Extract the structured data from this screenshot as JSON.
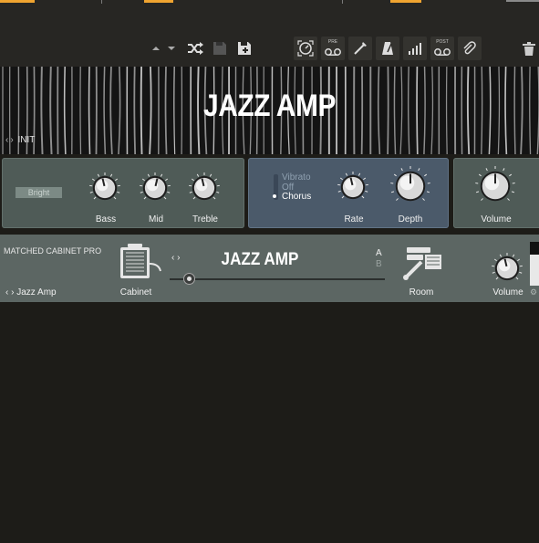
{
  "colors": {
    "accent": "#f0a430",
    "background": "#1d1c18",
    "toolbar": "#272623",
    "amp_panel": "#4f5b57",
    "mod_panel": "#4b5a6a",
    "cab_panel": "#5c6663"
  },
  "toolbar": {
    "icons": [
      "chevron-up-icon",
      "chevron-down-icon",
      "shuffle-icon",
      "save-icon",
      "save-as-icon",
      "tuner-icon",
      "pre-tape-icon",
      "pick-icon",
      "metronome-icon",
      "level-meter-icon",
      "post-tape-icon",
      "paperclip-icon",
      "trash-icon"
    ],
    "pre_label": "PRE",
    "post_label": "POST"
  },
  "amp": {
    "title": "JAZZ AMP",
    "preset_name": "INIT"
  },
  "eq_panel": {
    "bright_label": "Bright",
    "bright_on": false,
    "knobs": [
      {
        "label": "Bass",
        "value": 0.45
      },
      {
        "label": "Mid",
        "value": 0.55
      },
      {
        "label": "Treble",
        "value": 0.45
      }
    ]
  },
  "mod_panel": {
    "options": [
      "Vibrato",
      "Off",
      "Chorus"
    ],
    "selected": "Chorus",
    "knobs": [
      {
        "label": "Rate",
        "value": 0.45
      },
      {
        "label": "Depth",
        "value": 0.5
      }
    ]
  },
  "volume_panel": {
    "label": "Volume",
    "value": 0.5
  },
  "cabinet": {
    "section_title": "MATCHED CABINET PRO",
    "preset_name": "Jazz Amp",
    "cabinet_label": "Cabinet",
    "cabinet_name": "JAZZ AMP",
    "ab_a": "A",
    "ab_b": "B",
    "slider_value": 0.08,
    "room_label": "Room",
    "volume_label": "Volume",
    "volume_value": 0.45
  }
}
